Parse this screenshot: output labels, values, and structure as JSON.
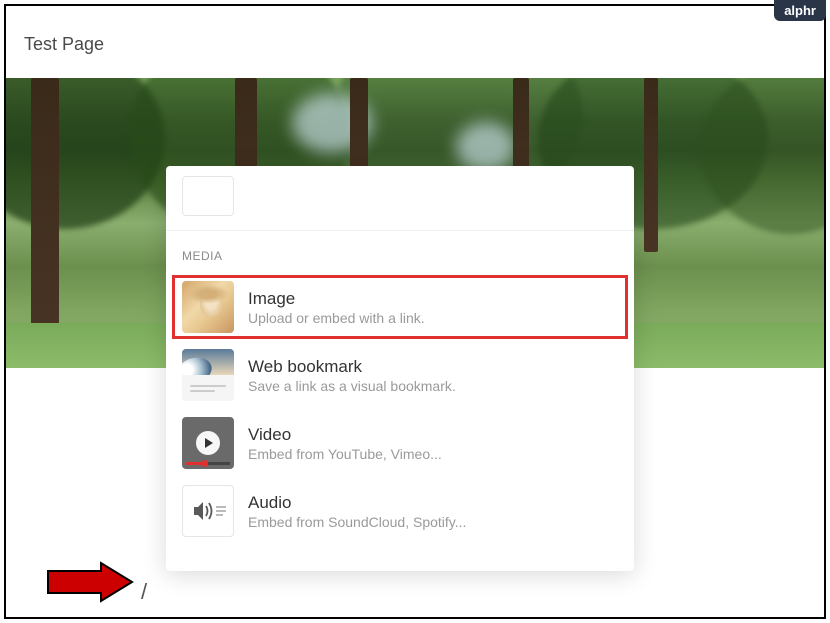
{
  "badge": "alphr",
  "page_title": "Test Page",
  "slash_trigger": "/",
  "menu": {
    "section_label": "MEDIA",
    "items": [
      {
        "title": "Image",
        "desc": "Upload or embed with a link."
      },
      {
        "title": "Web bookmark",
        "desc": "Save a link as a visual bookmark."
      },
      {
        "title": "Video",
        "desc": "Embed from YouTube, Vimeo..."
      },
      {
        "title": "Audio",
        "desc": "Embed from SoundCloud, Spotify..."
      }
    ]
  }
}
